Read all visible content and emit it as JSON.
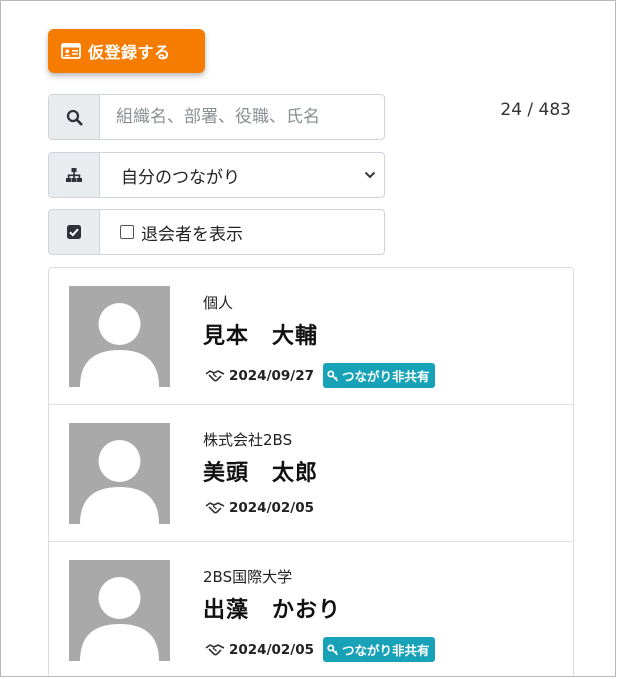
{
  "register_button": {
    "label": "仮登録する",
    "icon": "id-card-icon"
  },
  "count": "24 / 483",
  "search": {
    "placeholder": "組織名、部署、役職、氏名",
    "value": ""
  },
  "filter": {
    "selected": "自分のつながり"
  },
  "retired": {
    "label": "退会者を表示",
    "checked": false
  },
  "contacts": [
    {
      "org": "個人",
      "name": "見本　大輔",
      "date": "2024/09/27",
      "tag": "つながり非共有"
    },
    {
      "org": "株式会社2BS",
      "name": "美頭　太郎",
      "date": "2024/02/05"
    },
    {
      "org": "2BS国際大学",
      "name": "出藻　かおり",
      "date": "2024/02/05",
      "tag": "つながり非共有"
    }
  ],
  "colors": {
    "accent": "#f57c00",
    "tag": "#17a2b8",
    "avatar": "#a9a9a9"
  }
}
